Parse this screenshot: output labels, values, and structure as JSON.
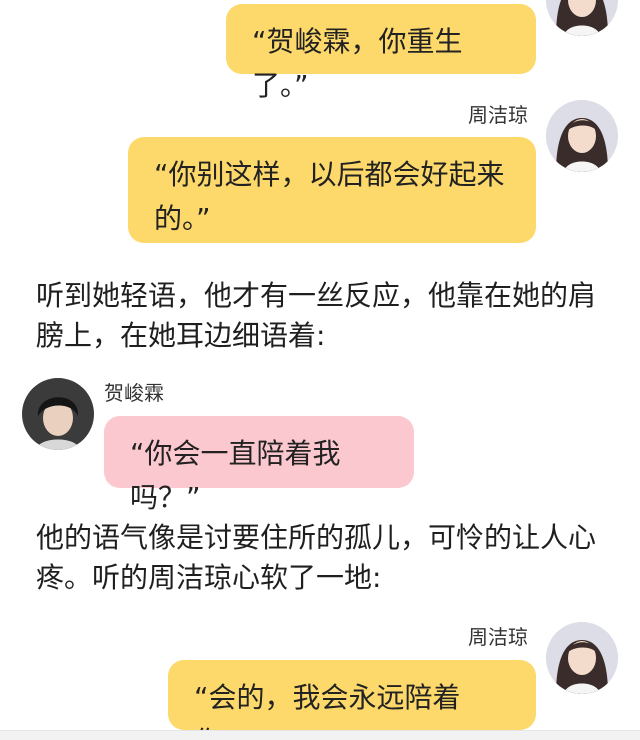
{
  "messages": [
    {
      "speaker": "",
      "text": "“贺峻霖，你重生了。”"
    },
    {
      "speaker": "周洁琼",
      "text": "“你别这样，以后都会好起来的。”"
    },
    {
      "speaker": "贺峻霖",
      "text": "“你会一直陪着我吗？”"
    },
    {
      "speaker": "周洁琼",
      "text": "“会的，我会永远陪着你。”"
    }
  ],
  "narration": [
    "听到她轻语，他才有一丝反应，他靠在她的肩膀上，在她耳边细语着:",
    "他的语气像是讨要住所的孤儿，可怜的让人心疼。听的周洁琼心软了一地:"
  ],
  "colors": {
    "yellow_bubble": "#fdd96b",
    "pink_bubble": "#fcc8cf"
  }
}
